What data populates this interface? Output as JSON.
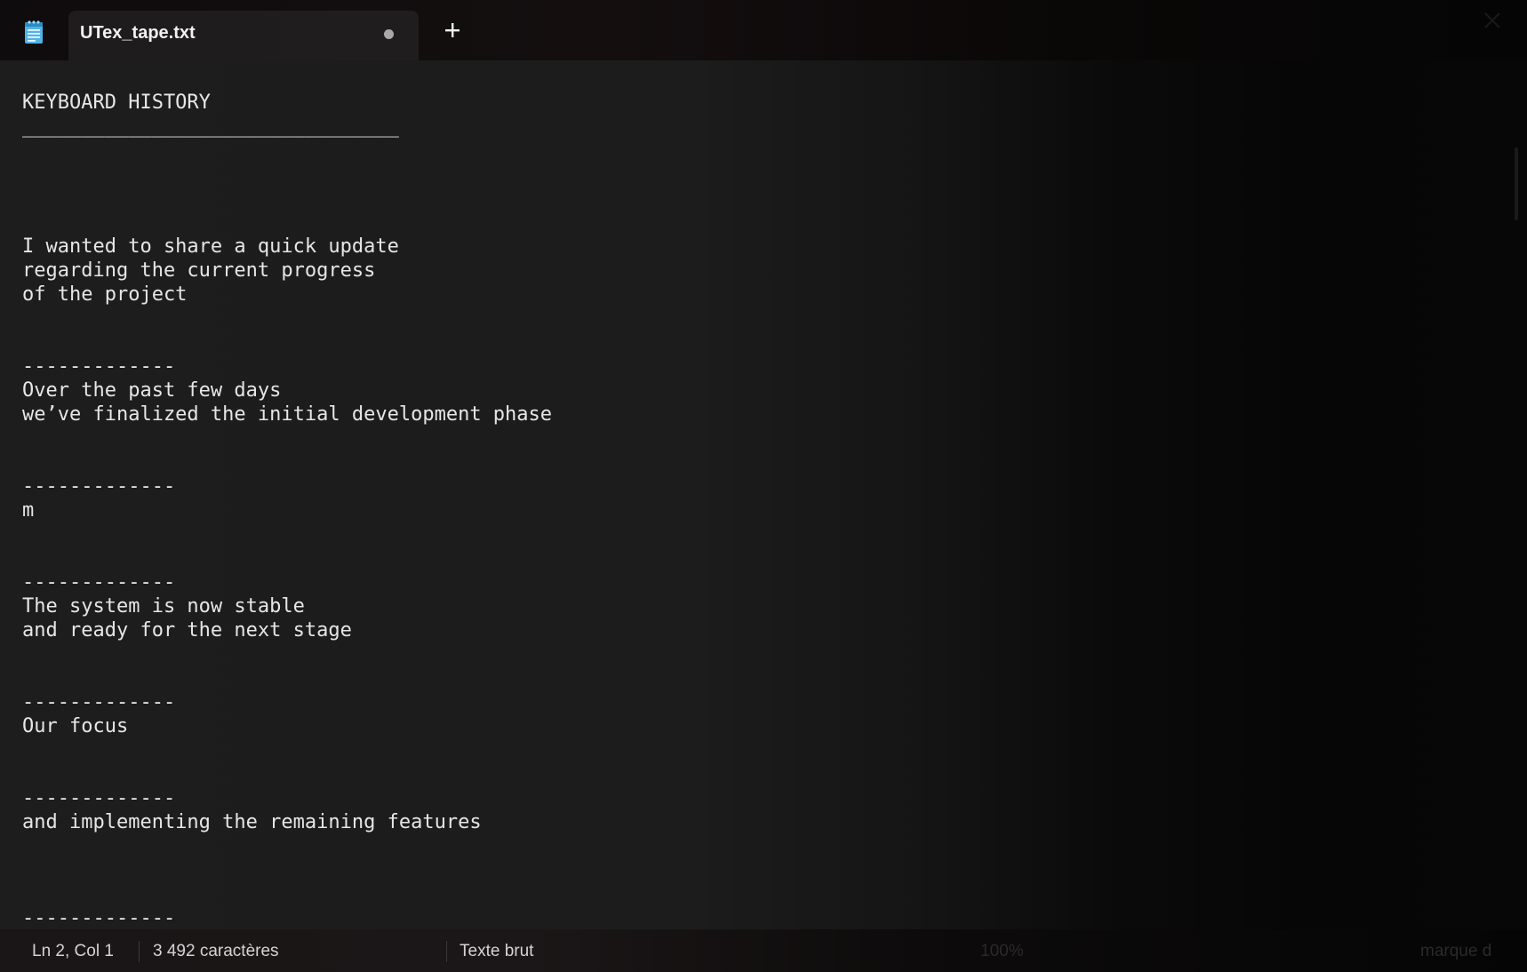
{
  "tab": {
    "title": "UTex_tape.txt",
    "unsaved_indicator": "●",
    "new_tab_label": "+"
  },
  "icons": {
    "app": "notepad-icon",
    "new_tab": "plus-icon",
    "close": "close-icon"
  },
  "editor": {
    "content": "KEYBOARD HISTORY\n________________________________\n\n\n\n\nI wanted to share a quick update\nregarding the current progress\nof the project\n\n\n-------------\nOver the past few days\nwe’ve finalized the initial development phase\n\n\n-------------\nm\n\n\n-------------\nThe system is now stable\nand ready for the next stage\n\n\n-------------\nOur focus\n\n\n-------------\nand implementing the remaining features\n\n\n\n-------------\nWe are also reviewing"
  },
  "status": {
    "position": "Ln 2, Col 1",
    "characters": "3 492 caractères",
    "encoding_type": "Texte brut",
    "zoom": "100%",
    "line_ending": "marque d"
  },
  "colors": {
    "text": "#e6e6e6",
    "background": "#1d1d1d",
    "tab_background": "#1f1c1d"
  }
}
